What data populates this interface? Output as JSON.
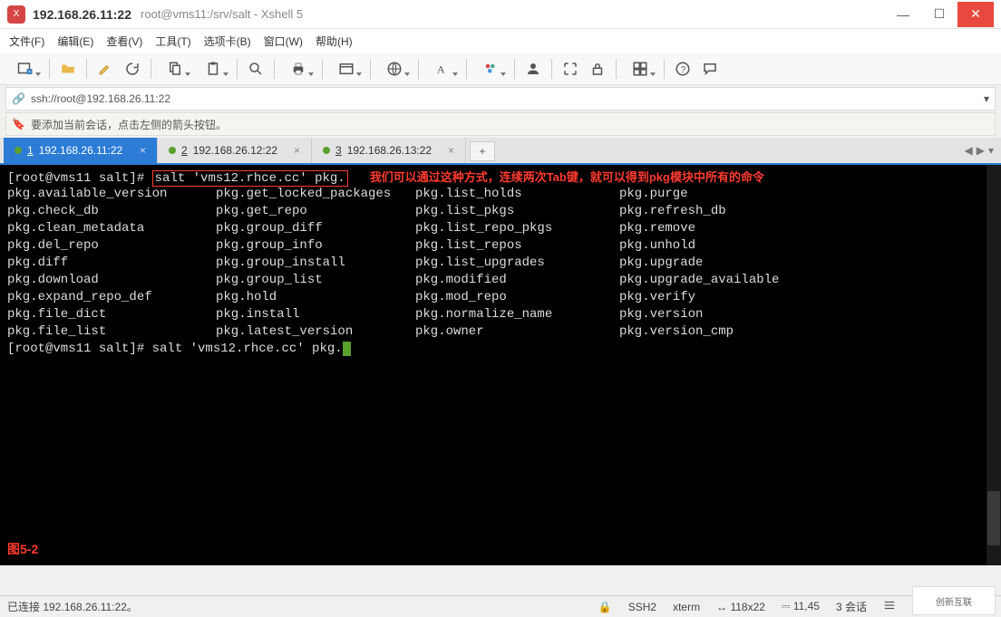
{
  "window": {
    "title_main": "192.168.26.11:22",
    "title_sub": "root@vms11:/srv/salt - Xshell 5"
  },
  "menu": {
    "file": "文件(F)",
    "edit": "编辑(E)",
    "view": "查看(V)",
    "tools": "工具(T)",
    "tabs": "选项卡(B)",
    "window": "窗口(W)",
    "help": "帮助(H)"
  },
  "address": {
    "url": "ssh://root@192.168.26.11:22"
  },
  "hint": {
    "text": "要添加当前会话，点击左侧的箭头按钮。"
  },
  "tabs": [
    {
      "num": "1",
      "label": "192.168.26.11:22",
      "active": true
    },
    {
      "num": "2",
      "label": "192.168.26.12:22",
      "active": false
    },
    {
      "num": "3",
      "label": "192.168.26.13:22",
      "active": false
    }
  ],
  "terminal": {
    "prompt1": "[root@vms11 salt]# ",
    "cmd_highlight": "salt 'vms12.rhce.cc' pkg.",
    "annotation": "我们可以通过这种方式，连续两次Tab键，就可以得到pkg模块中所有的命令",
    "columns": {
      "c1": [
        "pkg.available_version",
        "pkg.check_db",
        "pkg.clean_metadata",
        "pkg.del_repo",
        "pkg.diff",
        "pkg.download",
        "pkg.expand_repo_def",
        "pkg.file_dict",
        "pkg.file_list"
      ],
      "c2": [
        "pkg.get_locked_packages",
        "pkg.get_repo",
        "pkg.group_diff",
        "pkg.group_info",
        "pkg.group_install",
        "pkg.group_list",
        "pkg.hold",
        "pkg.install",
        "pkg.latest_version"
      ],
      "c3": [
        "pkg.list_holds",
        "pkg.list_pkgs",
        "pkg.list_repo_pkgs",
        "pkg.list_repos",
        "pkg.list_upgrades",
        "pkg.modified",
        "pkg.mod_repo",
        "pkg.normalize_name",
        "pkg.owner"
      ],
      "c4": [
        "pkg.purge",
        "pkg.refresh_db",
        "pkg.remove",
        "pkg.unhold",
        "pkg.upgrade",
        "pkg.upgrade_available",
        "pkg.verify",
        "pkg.version",
        "pkg.version_cmp"
      ]
    },
    "prompt2_text": "[root@vms11 salt]# salt 'vms12.rhce.cc' pkg.",
    "figure_label": "图5-2"
  },
  "status": {
    "connected": "已连接  192.168.26.11:22。",
    "ssh": "SSH2",
    "term": "xterm",
    "size": "118x22",
    "pos": "11,45",
    "sessions": "3 会话"
  },
  "watermark": "创新互联"
}
